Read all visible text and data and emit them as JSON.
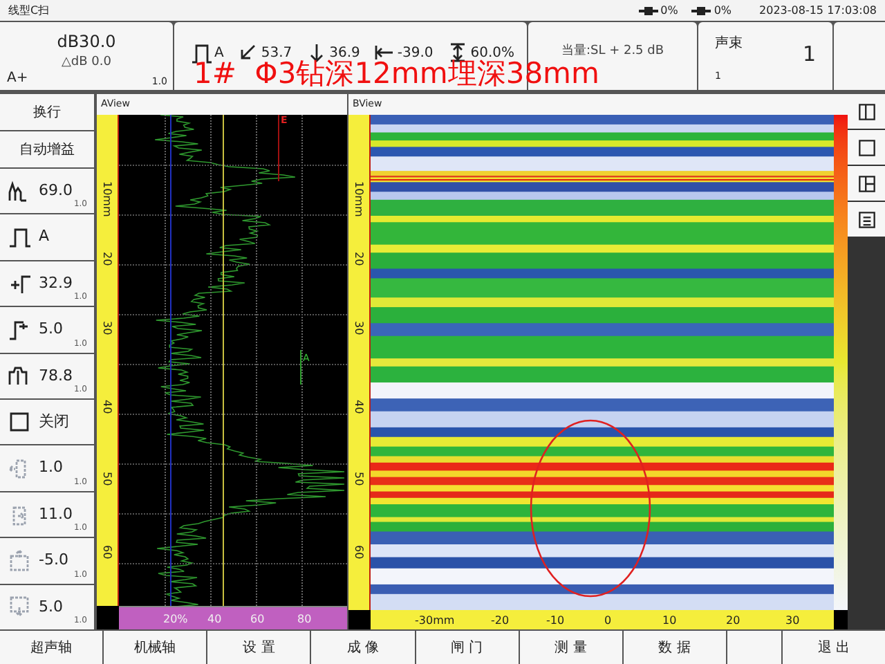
{
  "status_bar": {
    "mode": "线型C扫",
    "battery_1": "0%",
    "battery_2": "0%",
    "datetime": "2023-08-15 17:03:08"
  },
  "header": {
    "gain": {
      "value": "dB30.0",
      "delta": "△dB 0.0",
      "mode": "A+",
      "step": "1.0"
    },
    "readings": [
      {
        "text": "A"
      },
      {
        "text": "53.7"
      },
      {
        "text": "36.9"
      },
      {
        "text": "-39.0"
      },
      {
        "text": "60.0%"
      }
    ],
    "equivalent": "当量:SL + 2.5 dB",
    "beam": {
      "label": "声束",
      "value": "1",
      "sub": "1"
    }
  },
  "annotation": {
    "text": "1#  Φ3钻深12mm埋深38mm"
  },
  "sidebar": [
    {
      "kind": "button",
      "label": "换行"
    },
    {
      "kind": "button",
      "label": "自动增益"
    },
    {
      "kind": "param",
      "value": "69.0",
      "step": "1.0",
      "disabled": false
    },
    {
      "kind": "param",
      "value": "A",
      "disabled": false
    },
    {
      "kind": "param",
      "value": "32.9",
      "step": "1.0",
      "disabled": false
    },
    {
      "kind": "param",
      "value": "5.0",
      "step": "1.0",
      "disabled": false
    },
    {
      "kind": "param",
      "value": "78.8",
      "step": "1.0",
      "disabled": false
    },
    {
      "kind": "param",
      "value": "关闭",
      "disabled": false
    },
    {
      "kind": "param",
      "value": "1.0",
      "step": "1.0",
      "disabled": true
    },
    {
      "kind": "param",
      "value": "11.0",
      "step": "1.0",
      "disabled": true
    },
    {
      "kind": "param",
      "value": "-5.0",
      "step": "1.0",
      "disabled": true
    },
    {
      "kind": "param",
      "value": "5.0",
      "step": "1.0",
      "disabled": true
    }
  ],
  "aview": {
    "title": "AView",
    "gate_e": "E",
    "gate_a": "A",
    "depth_labels": [
      "10mm",
      "20",
      "30",
      "40",
      "50",
      "60"
    ],
    "amplitude_labels": [
      "20%",
      "40",
      "60",
      "80"
    ]
  },
  "bview": {
    "title": "BView",
    "depth_labels": [
      "10mm",
      "20",
      "30",
      "40",
      "50",
      "60"
    ],
    "x_labels": [
      "-30mm",
      "-20",
      "-10",
      "0",
      "10",
      "20",
      "30"
    ]
  },
  "bottom_menu": [
    {
      "label": "超声轴"
    },
    {
      "label": "机械轴"
    },
    {
      "label": "设 置"
    },
    {
      "label": "成 像"
    },
    {
      "label": "闸 门"
    },
    {
      "label": "测 量"
    },
    {
      "label": "数 据"
    },
    {
      "label": "退 出"
    }
  ]
}
